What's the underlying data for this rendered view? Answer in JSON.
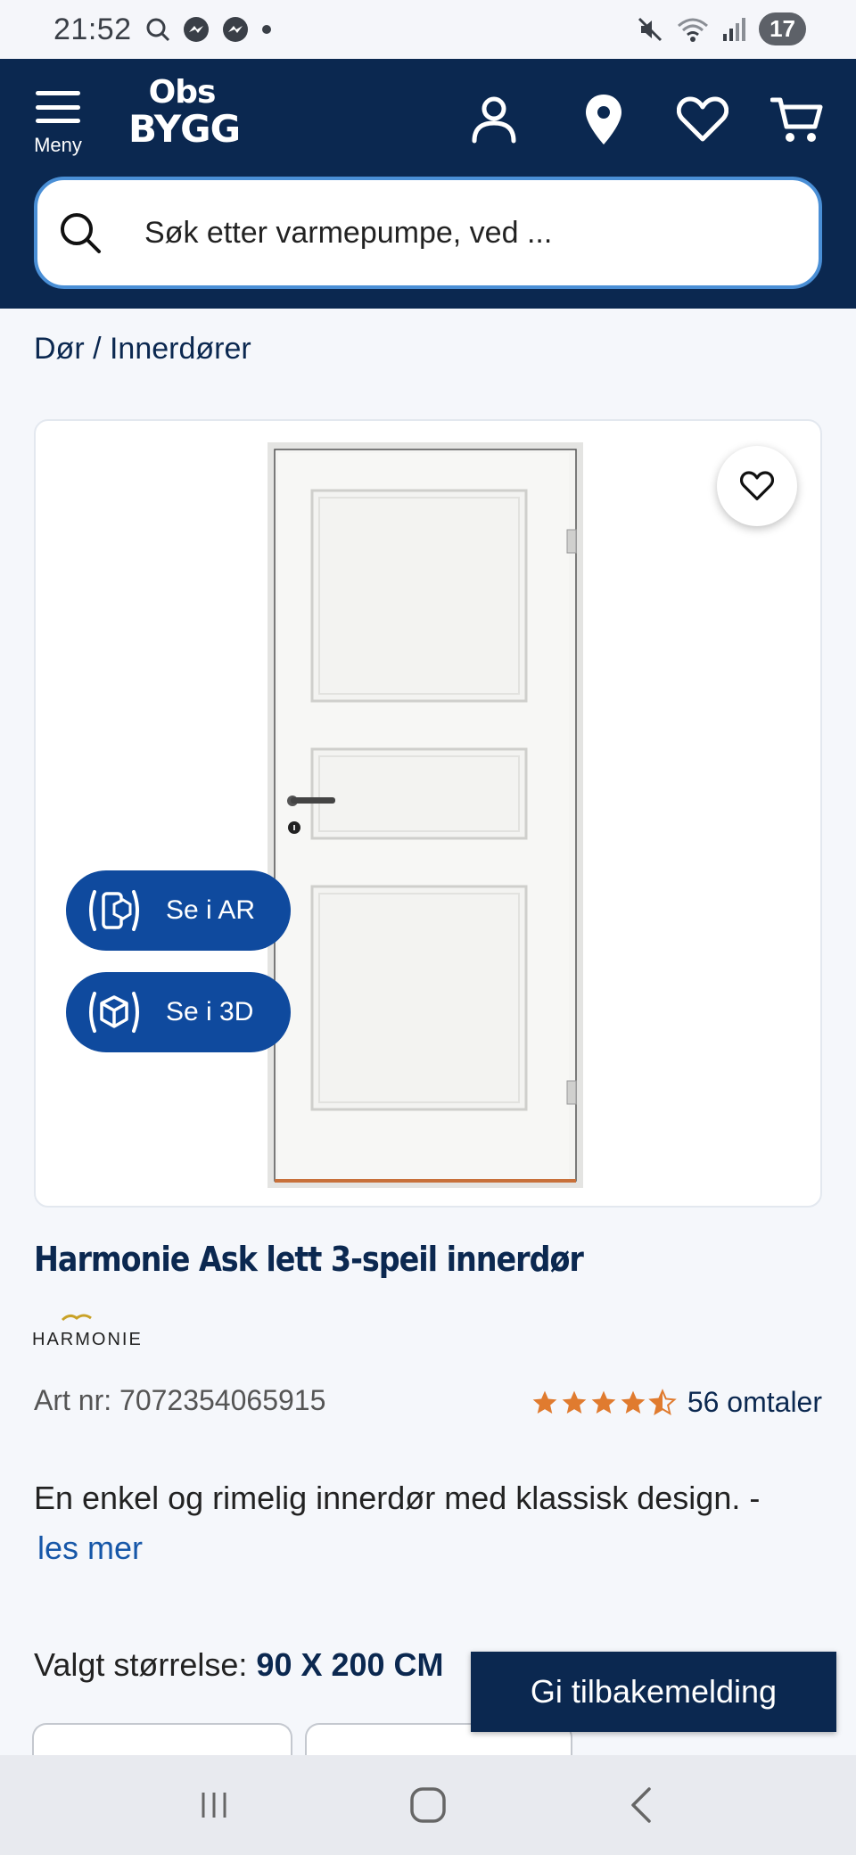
{
  "status_bar": {
    "time": "21:52",
    "battery": "17"
  },
  "header": {
    "menu_label": "Meny",
    "logo_line1": "Obs",
    "logo_line2": "BYGG",
    "search_placeholder": "Søk etter varmepumpe, ved ..."
  },
  "breadcrumb": "Dør / Innerdører",
  "product": {
    "title": "Harmonie Ask lett 3-speil innerdør",
    "brand": "HARMONIE",
    "art_nr": "Art nr: 7072354065915",
    "rating": 4.5,
    "review_count": "56 omtaler",
    "description": "En enkel og rimelig innerdør med klassisk design. -",
    "read_more": "les mer",
    "ar_label": "Se i AR",
    "three_d_label": "Se i 3D",
    "size_label": "Valgt størrelse:",
    "size_value": "90 X 200 CM"
  },
  "feedback_label": "Gi tilbakemelding",
  "colors": {
    "header_bg": "#0b2850",
    "accent_blue": "#0f4a9e",
    "star": "#e07b2f",
    "search_border": "#4a8fd6"
  }
}
